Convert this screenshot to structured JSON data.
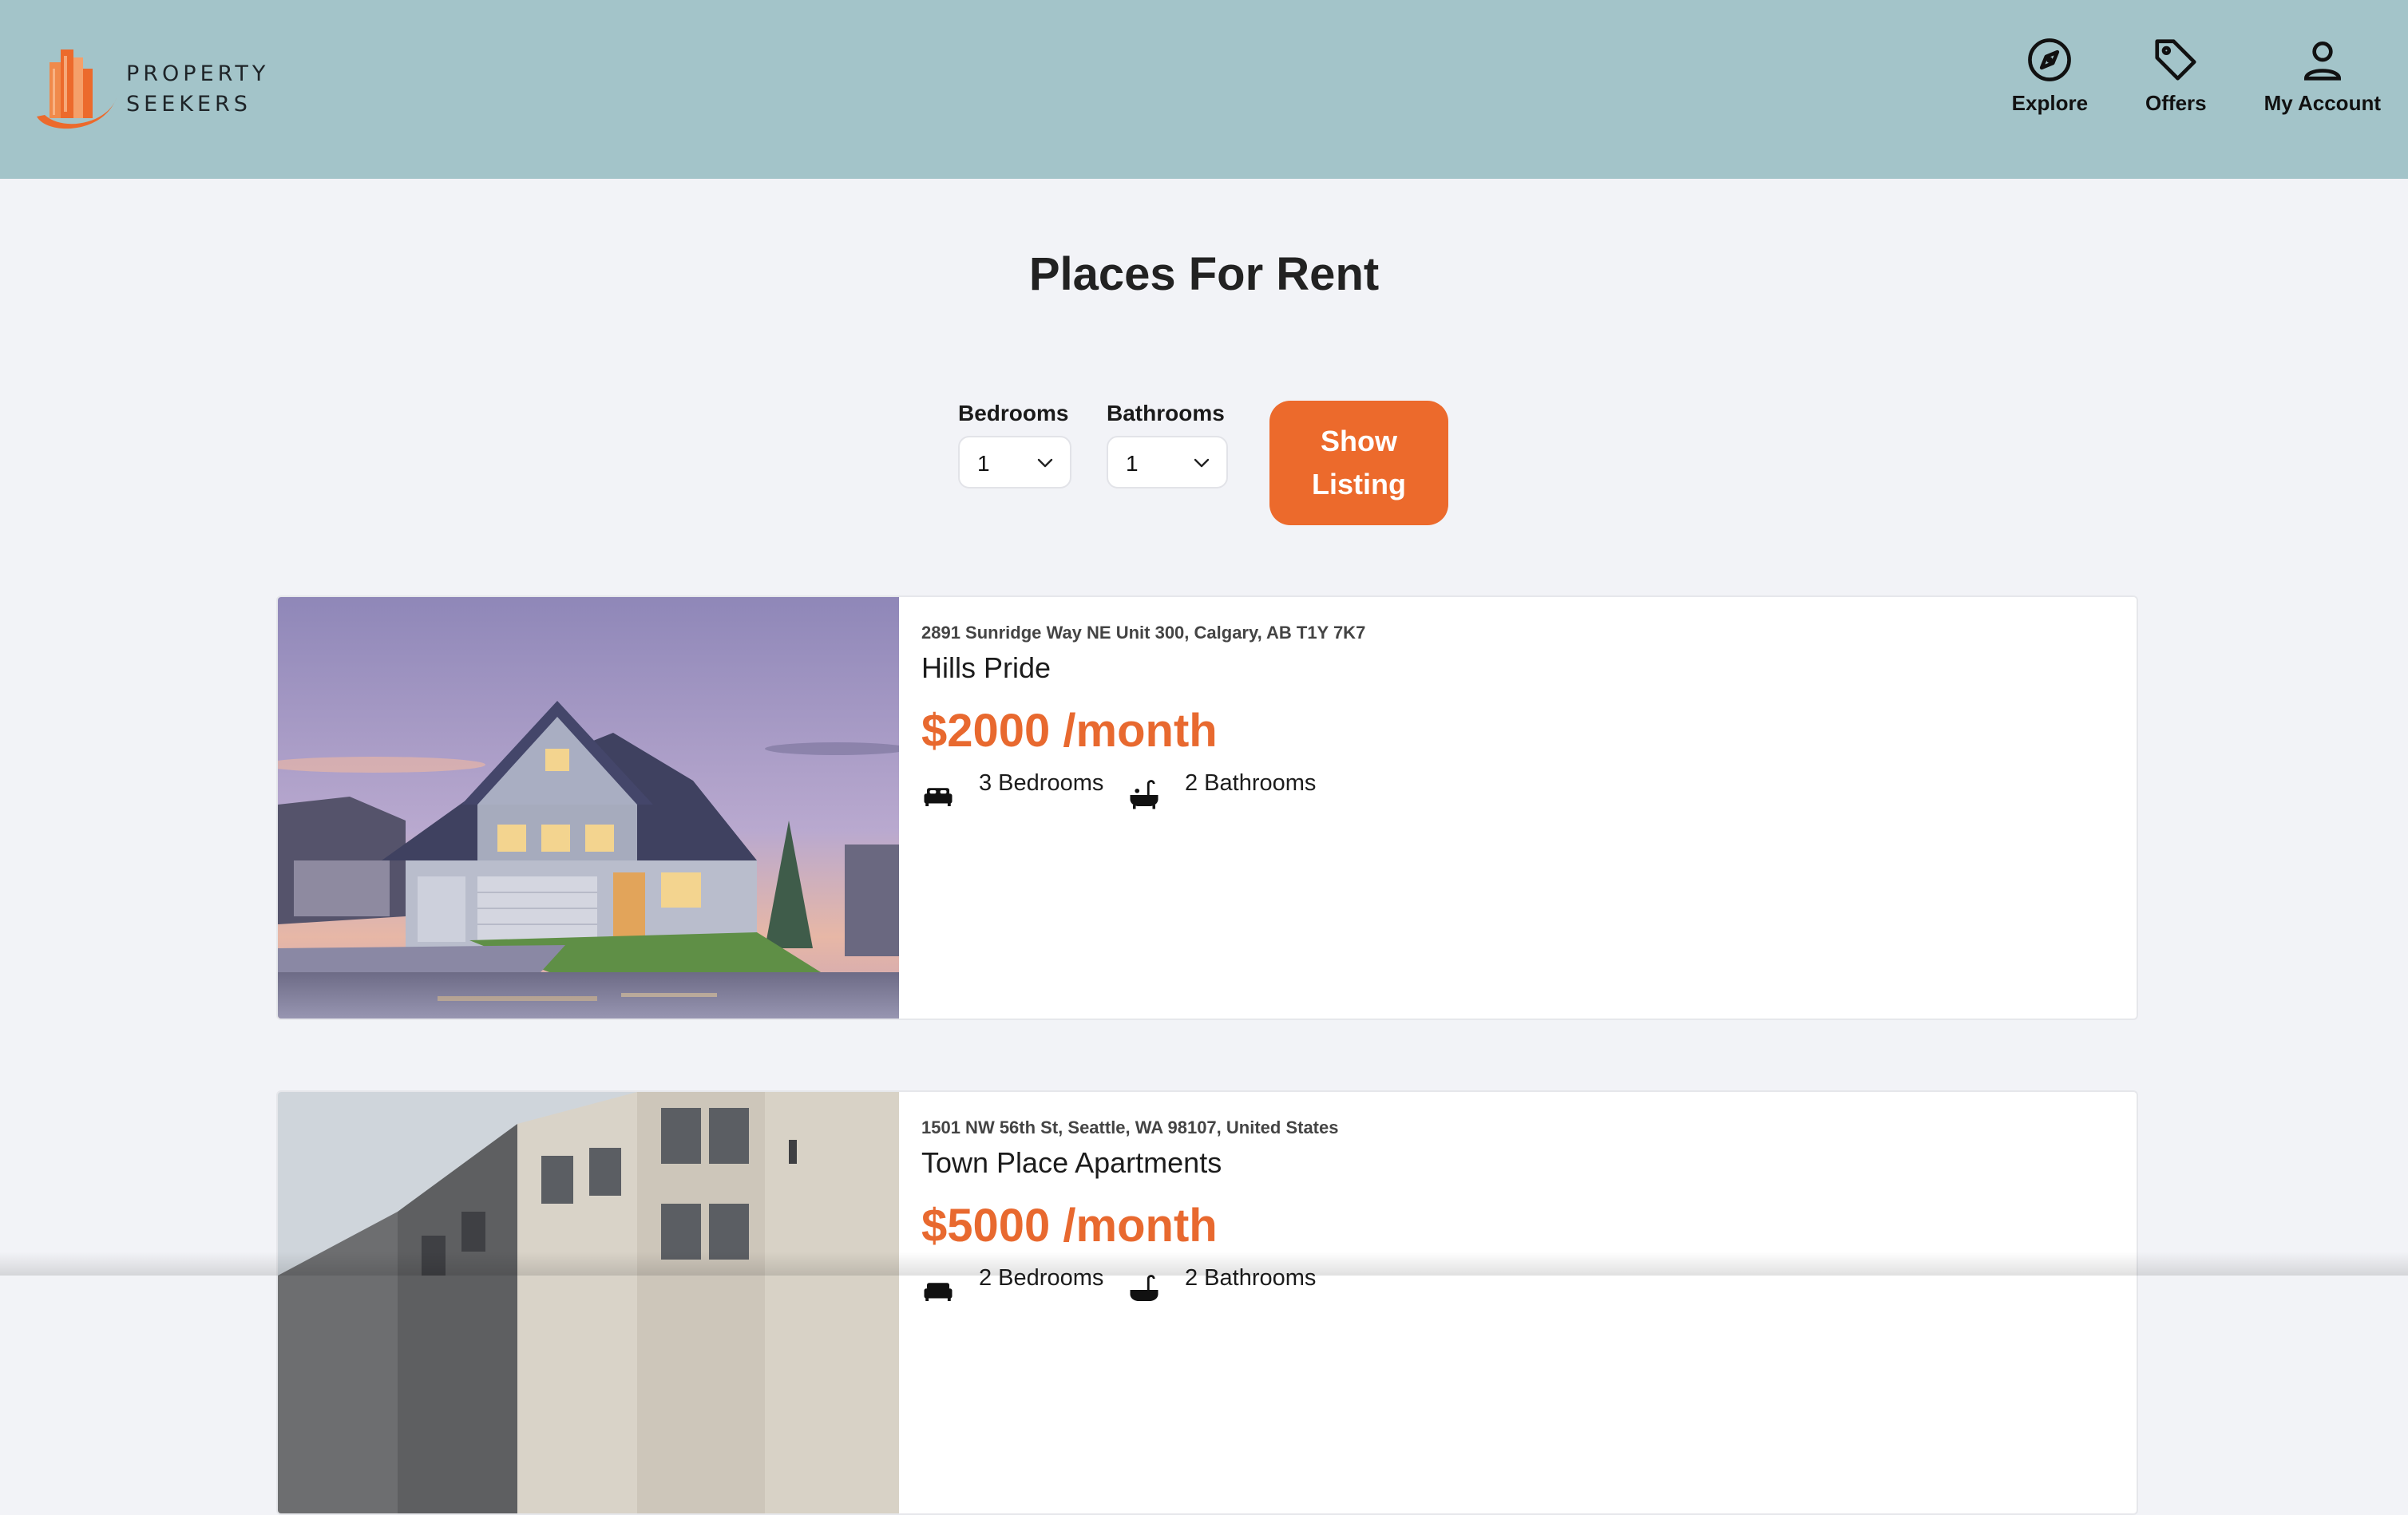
{
  "brand": {
    "line1": "PROPERTY",
    "line2": "SEEKERS",
    "accent": "#ec6a2c"
  },
  "header": {
    "background": "#a3c4c9"
  },
  "nav": [
    {
      "label": "Explore",
      "icon": "compass-icon"
    },
    {
      "label": "Offers",
      "icon": "tag-icon"
    },
    {
      "label": "My Account",
      "icon": "user-icon"
    }
  ],
  "page": {
    "title": "Places For Rent"
  },
  "filters": {
    "bedrooms": {
      "label": "Bedrooms",
      "value": "1"
    },
    "bathrooms": {
      "label": "Bathrooms",
      "value": "1"
    },
    "button_label": "Show Listing"
  },
  "listings": [
    {
      "address": "2891 Sunridge Way NE Unit 300, Calgary, AB T1Y 7K7",
      "name": "Hills Pride",
      "price": "$2000 /month",
      "bedrooms": "3 Bedrooms",
      "bathrooms": "2 Bathrooms",
      "image": "suburban-house-photo"
    },
    {
      "address": "1501 NW 56th St, Seattle, WA 98107, United States",
      "name": "Town Place Apartments",
      "price": "$5000 /month",
      "bedrooms": "2 Bedrooms",
      "bathrooms": "2 Bathrooms",
      "image": "townhouse-apartments-photo"
    }
  ]
}
